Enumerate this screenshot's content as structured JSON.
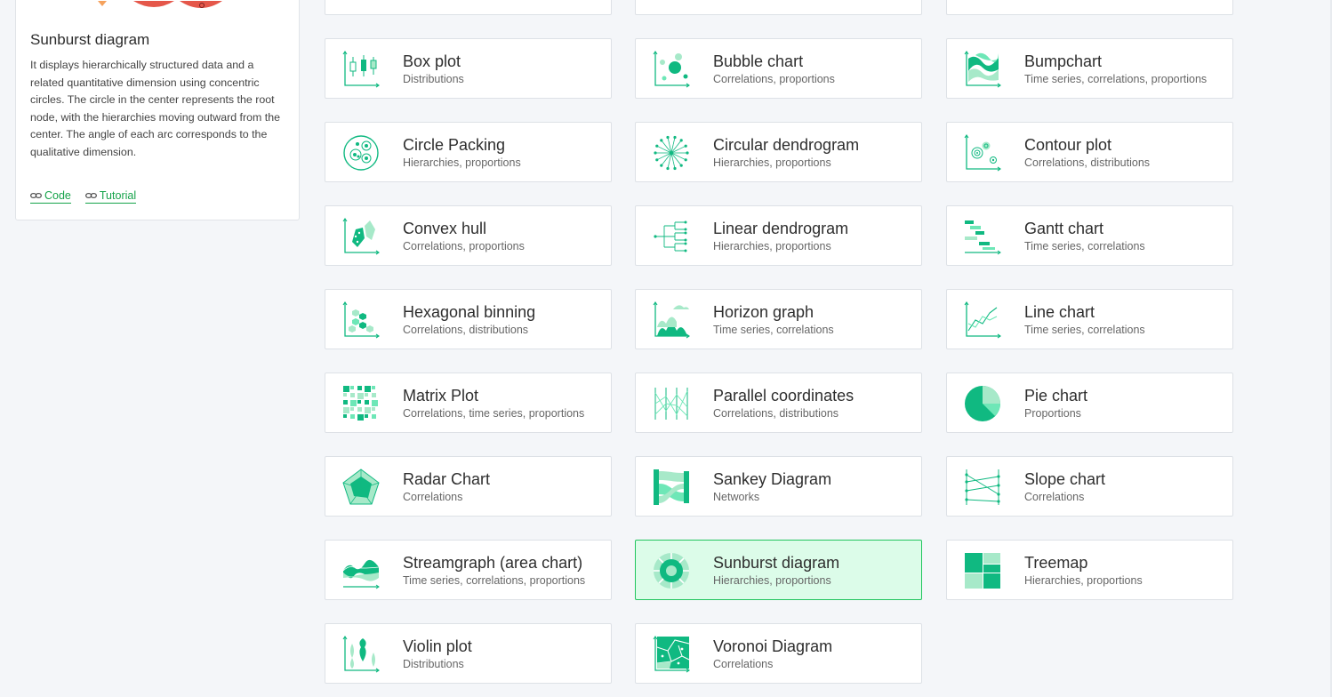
{
  "sidebar": {
    "title": "Sunburst diagram",
    "description": "It displays hierarchically structured data and a related quantitative dimension using concentric circles. The circle in the center represents the root node, with the hierarchies moving outward from the center. The angle of each arc corresponds to the qualitative dimension.",
    "links": {
      "code": "Code",
      "tutorial": "Tutorial"
    }
  },
  "colors": {
    "accent": "#16a34a",
    "iconGreen": "#10b981",
    "iconLight": "#a7e9c9",
    "selectedBg": "#dcfce9",
    "selectedBorder": "#22c55e"
  },
  "cards": [
    {
      "title": "Box plot",
      "subtitle": "Distributions",
      "icon": "box-plot-icon"
    },
    {
      "title": "Bubble chart",
      "subtitle": "Correlations, proportions",
      "icon": "bubble-chart-icon"
    },
    {
      "title": "Bumpchart",
      "subtitle": "Time series, correlations, proportions",
      "icon": "bumpchart-icon"
    },
    {
      "title": "Circle Packing",
      "subtitle": "Hierarchies, proportions",
      "icon": "circle-packing-icon"
    },
    {
      "title": "Circular dendrogram",
      "subtitle": "Hierarchies, proportions",
      "icon": "circular-dendrogram-icon"
    },
    {
      "title": "Contour plot",
      "subtitle": "Correlations, distributions",
      "icon": "contour-plot-icon"
    },
    {
      "title": "Convex hull",
      "subtitle": "Correlations, proportions",
      "icon": "convex-hull-icon"
    },
    {
      "title": "Linear dendrogram",
      "subtitle": "Hierarchies, proportions",
      "icon": "linear-dendrogram-icon"
    },
    {
      "title": "Gantt chart",
      "subtitle": "Time series, correlations",
      "icon": "gantt-chart-icon"
    },
    {
      "title": "Hexagonal binning",
      "subtitle": "Correlations, distributions",
      "icon": "hexagonal-binning-icon"
    },
    {
      "title": "Horizon graph",
      "subtitle": "Time series, correlations",
      "icon": "horizon-graph-icon"
    },
    {
      "title": "Line chart",
      "subtitle": "Time series, correlations",
      "icon": "line-chart-icon"
    },
    {
      "title": "Matrix Plot",
      "subtitle": "Correlations, time series, proportions",
      "icon": "matrix-plot-icon"
    },
    {
      "title": "Parallel coordinates",
      "subtitle": "Correlations, distributions",
      "icon": "parallel-coordinates-icon"
    },
    {
      "title": "Pie chart",
      "subtitle": "Proportions",
      "icon": "pie-chart-icon"
    },
    {
      "title": "Radar Chart",
      "subtitle": "Correlations",
      "icon": "radar-chart-icon"
    },
    {
      "title": "Sankey Diagram",
      "subtitle": "Networks",
      "icon": "sankey-diagram-icon"
    },
    {
      "title": "Slope chart",
      "subtitle": "Correlations",
      "icon": "slope-chart-icon"
    },
    {
      "title": "Streamgraph (area chart)",
      "subtitle": "Time series, correlations, proportions",
      "icon": "streamgraph-icon"
    },
    {
      "title": "Sunburst diagram",
      "subtitle": "Hierarchies, proportions",
      "icon": "sunburst-diagram-icon",
      "selected": true
    },
    {
      "title": "Treemap",
      "subtitle": "Hierarchies, proportions",
      "icon": "treemap-icon"
    },
    {
      "title": "Violin plot",
      "subtitle": "Distributions",
      "icon": "violin-plot-icon"
    },
    {
      "title": "Voronoi Diagram",
      "subtitle": "Correlations",
      "icon": "voronoi-diagram-icon"
    }
  ]
}
